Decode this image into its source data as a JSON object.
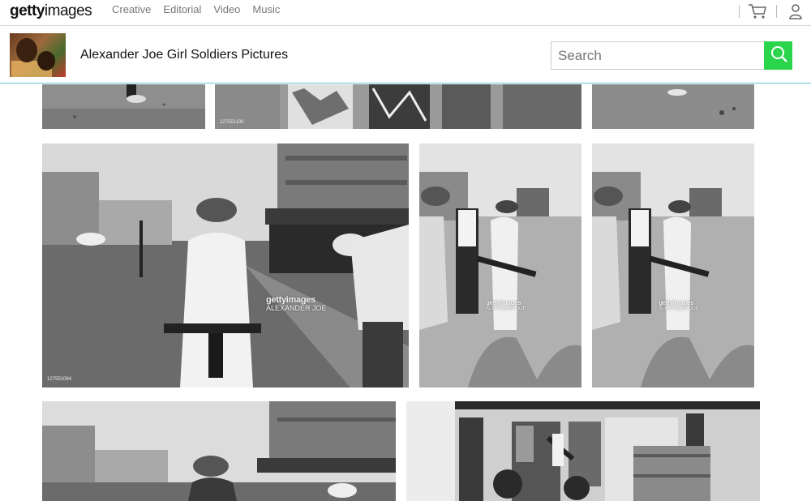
{
  "brand": {
    "logo_bold": "getty",
    "logo_light": "images"
  },
  "nav": {
    "items": [
      "Creative",
      "Editorial",
      "Video",
      "Music"
    ]
  },
  "header": {
    "title": "Alexander Joe Girl Soldiers Pictures"
  },
  "search": {
    "placeholder": "Search"
  },
  "photos": {
    "top1_id": "",
    "top2_id": "127551100",
    "big_id": "127551084",
    "watermark_brand": "gettyimages",
    "watermark_credit": "ALEXANDER JOE"
  },
  "colors": {
    "accent_green": "#2bd54b",
    "divider_teal": "#5dc9d6"
  }
}
